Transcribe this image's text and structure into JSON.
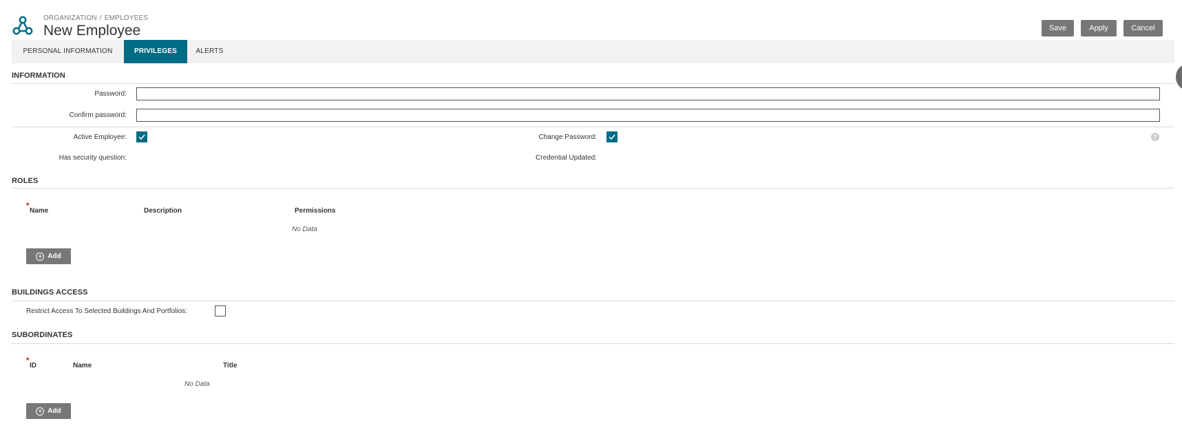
{
  "header": {
    "breadcrumb": [
      "ORGANIZATION",
      "EMPLOYEES"
    ],
    "breadcrumb_sep": "/",
    "title": "New Employee",
    "logo_icon": "network-nodes-icon",
    "accent_color": "#006c84"
  },
  "toolbar": {
    "save_label": "Save",
    "apply_label": "Apply",
    "cancel_label": "Cancel"
  },
  "tabs": [
    {
      "label": "PERSONAL INFORMATION",
      "active": false
    },
    {
      "label": "PRIVILEGES",
      "active": true
    },
    {
      "label": "ALERTS",
      "active": false
    }
  ],
  "information": {
    "section_title": "INFORMATION",
    "password_label": "Password:",
    "password_value": "",
    "confirm_password_label": "Confirm password:",
    "confirm_password_value": "",
    "active_employee_label": "Active Employee:",
    "active_employee_checked": true,
    "change_password_label": "Change Password:",
    "change_password_checked": true,
    "help_icon": "question-mark-icon",
    "has_security_question_label": "Has security question:",
    "credential_updated_label": "Credential Updated:"
  },
  "roles": {
    "section_title": "ROLES",
    "required_mark": "*",
    "columns": [
      "Name",
      "Description",
      "Permissions"
    ],
    "no_data": "No Data",
    "add_label": "Add"
  },
  "buildings": {
    "section_title": "BUILDINGS ACCESS",
    "restrict_label": "Restrict Access To Selected Buildings And Portfolios:",
    "restrict_checked": false
  },
  "subordinates": {
    "section_title": "SUBORDINATES",
    "required_mark": "*",
    "columns": [
      "ID",
      "Name",
      "Title"
    ],
    "no_data": "No Data",
    "add_label": "Add"
  }
}
